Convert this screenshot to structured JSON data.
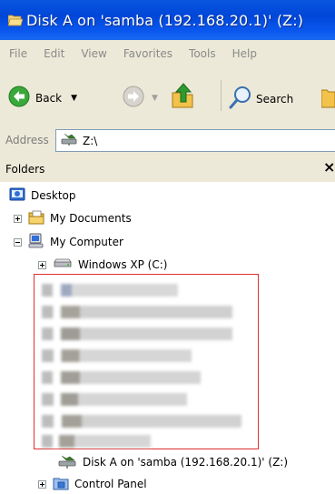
{
  "window": {
    "title": "Disk A on 'samba (192.168.20.1)' (Z:)"
  },
  "menu": [
    "File",
    "Edit",
    "View",
    "Favorites",
    "Tools",
    "Help"
  ],
  "toolbar": {
    "back_label": "Back",
    "search_label": "Search"
  },
  "address": {
    "label": "Address",
    "value": "Z:\\"
  },
  "folders_panel": {
    "title": "Folders",
    "close_glyph": "×"
  },
  "tree": {
    "desktop": "Desktop",
    "my_documents": "My Documents",
    "my_computer": "My Computer",
    "windows_xp": "Windows XP (C:)",
    "disk_a": "Disk A on 'samba (192.168.20.1)' (Z:)",
    "control_panel": "Control Panel"
  },
  "colors": {
    "title_bar": "#0a56e0",
    "redaction_border": "#e03030",
    "chrome": "#ece9d8"
  }
}
